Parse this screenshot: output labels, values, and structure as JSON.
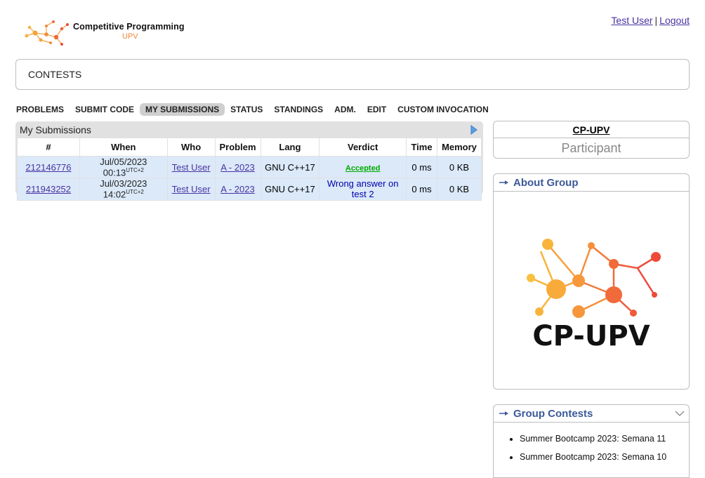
{
  "header": {
    "logo_title": "Competitive Programming",
    "logo_sub": "UPV",
    "user_link": "Test User",
    "separator": "|",
    "logout_link": "Logout"
  },
  "page_title": "CONTESTS",
  "menu": [
    {
      "label": "PROBLEMS",
      "active": false
    },
    {
      "label": "SUBMIT CODE",
      "active": false
    },
    {
      "label": "MY SUBMISSIONS",
      "active": true
    },
    {
      "label": "STATUS",
      "active": false
    },
    {
      "label": "STANDINGS",
      "active": false
    },
    {
      "label": "ADM.",
      "active": false
    },
    {
      "label": "EDIT",
      "active": false
    },
    {
      "label": "CUSTOM INVOCATION",
      "active": false
    }
  ],
  "submissions": {
    "title": "My Submissions",
    "columns": [
      "#",
      "When",
      "Who",
      "Problem",
      "Lang",
      "Verdict",
      "Time",
      "Memory"
    ],
    "rows": [
      {
        "id": "212146776",
        "when": "Jul/05/2023 00:13",
        "tz": "UTC+2",
        "who": "Test User",
        "problem": "A - 2023",
        "lang": "GNU C++17",
        "verdict": "Accepted",
        "time": "0 ms",
        "memory": "0 KB"
      },
      {
        "id": "211943252",
        "when": "Jul/03/2023 14:02",
        "tz": "UTC+2",
        "who": "Test User",
        "problem": "A - 2023",
        "lang": "GNU C++17",
        "verdict": "Wrong answer on test 2",
        "time": "0 ms",
        "memory": "0 KB"
      }
    ]
  },
  "sidebar": {
    "group_name": "CP-UPV",
    "group_role": "Participant",
    "about_title": "About Group",
    "about_logo_text": "CP-UPV",
    "contests_title": "Group Contests",
    "contests": [
      "Summer Bootcamp 2023: Semana 11",
      "Summer Bootcamp 2023: Semana 10"
    ]
  },
  "colors": {
    "accent_orange": "#f0893a",
    "link": "#4a32a0",
    "accepted": "#00aa00",
    "wrong": "#0000aa",
    "row_bg": "#dbe9f9",
    "sidebar_head": "#3b5998"
  }
}
